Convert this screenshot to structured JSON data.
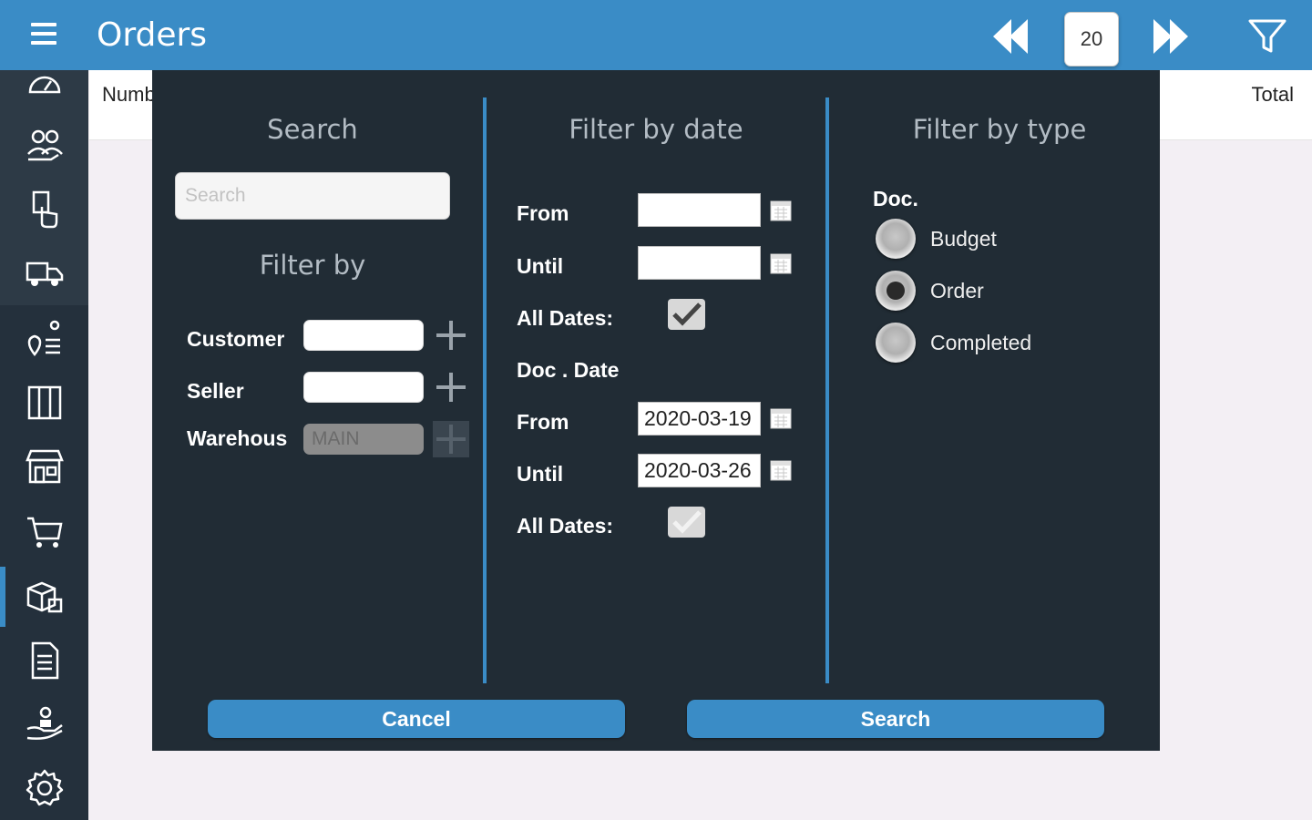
{
  "header": {
    "title": "Orders",
    "page_value": "20"
  },
  "list": {
    "col_number": "Numb",
    "col_total": "Total"
  },
  "search_section": {
    "title": "Search",
    "search_placeholder": "Search",
    "filter_by_title": "Filter by",
    "customer_label": "Customer",
    "customer_value": "",
    "seller_label": "Seller",
    "seller_value": "",
    "warehouse_label": "Warehous",
    "warehouse_value": "MAIN"
  },
  "date_section": {
    "title": "Filter by date",
    "from_label": "From",
    "from_value": "",
    "until_label": "Until",
    "until_value": "",
    "all_dates_label": "All Dates:",
    "all_dates_checked": true,
    "doc_date_title": "Doc . Date",
    "doc_from_label": "From",
    "doc_from_value": "2020-03-19",
    "doc_until_label": "Until",
    "doc_until_value": "2020-03-26",
    "doc_all_dates_label": "All Dates:",
    "doc_all_dates_checked": false
  },
  "type_section": {
    "title": "Filter by type",
    "doc_label": "Doc.",
    "options": [
      {
        "label": "Budget",
        "selected": false
      },
      {
        "label": "Order",
        "selected": true
      },
      {
        "label": "Completed",
        "selected": false
      }
    ]
  },
  "buttons": {
    "cancel": "Cancel",
    "search": "Search"
  },
  "sidebar": {
    "items": [
      {
        "icon": "dashboard-icon"
      },
      {
        "icon": "customers-icon"
      },
      {
        "icon": "touch-document-icon"
      },
      {
        "icon": "delivery-truck-icon"
      },
      {
        "icon": "route-location-icon"
      },
      {
        "icon": "inventory-shelves-icon"
      },
      {
        "icon": "store-icon"
      },
      {
        "icon": "shopping-cart-icon"
      },
      {
        "icon": "orders-boxes-icon"
      },
      {
        "icon": "invoice-document-icon"
      },
      {
        "icon": "cash-hand-icon"
      },
      {
        "icon": "settings-gear-icon"
      }
    ],
    "active_index": 8
  },
  "colors": {
    "accent": "#3a8cc6",
    "dialog_bg": "#212c35",
    "sidebar_bg": "#24303c"
  }
}
